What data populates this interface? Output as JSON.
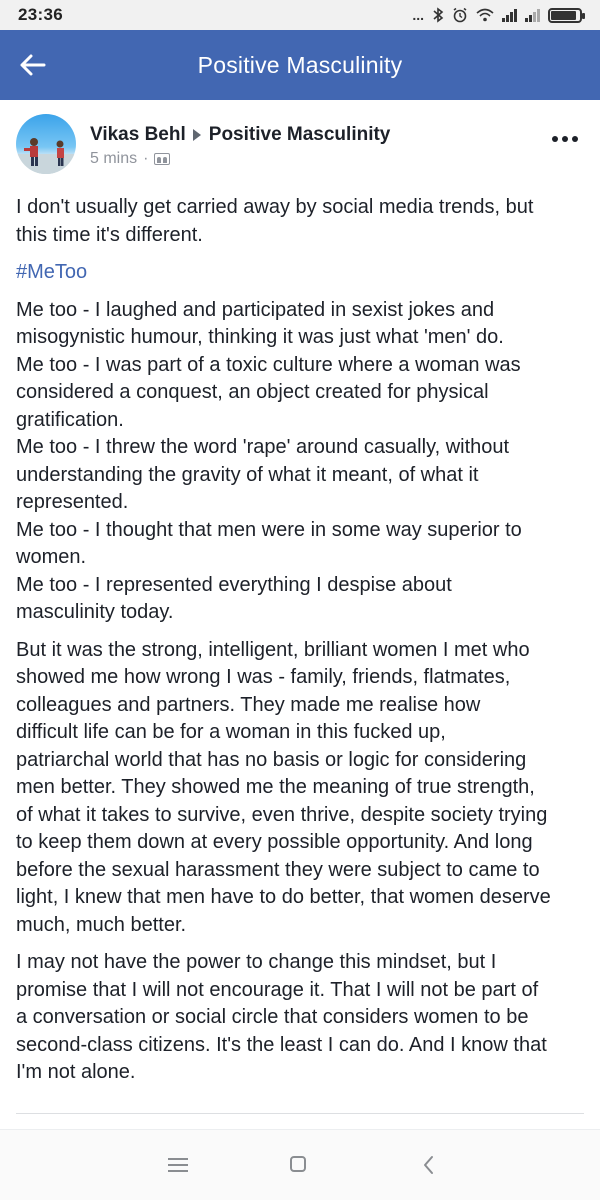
{
  "status_bar": {
    "time": "23:36",
    "dots": "...",
    "battery_level": 0.9
  },
  "app_bar": {
    "title": "Positive Masculinity"
  },
  "post": {
    "author": "Vikas Behl",
    "group": "Positive Masculinity",
    "time": "5 mins",
    "separator": "·",
    "intro_lines": [
      "I don't usually get carried away by social media trends, but",
      "this time it's different."
    ],
    "hashtag": "#MeToo",
    "metoo_lines": [
      "Me too - I laughed and participated in sexist jokes and",
      "misogynistic humour, thinking it was just what 'men' do.",
      "Me too - I was part of a toxic culture where a woman was",
      "considered a conquest, an object created for physical",
      "gratification.",
      "Me too - I threw the word 'rape' around casually, without",
      "understanding the gravity of what it meant, of what it",
      "represented.",
      "Me too - I thought that men were in some way superior to",
      "women.",
      "Me too - I represented everything I despise about",
      "masculinity today."
    ],
    "women_lines": [
      "But it was the strong, intelligent, brilliant women I met who",
      "showed me how wrong I was - family, friends, flatmates,",
      "colleagues and partners. They made me realise how",
      "difficult life can be for a woman in this fucked up,",
      "patriarchal world that has no basis or logic for considering",
      "men better. They showed me the meaning of true strength,",
      "of what it takes to survive, even thrive, despite society trying",
      "to keep them down at every possible opportunity. And long",
      "before the sexual harassment they were subject to came to",
      "light, I knew that men have to do better, that women deserve",
      "much, much better."
    ],
    "promise_lines": [
      "I may not have the power to change this mindset, but I",
      "promise that I will not encourage it. That I will not be part of",
      "a conversation or social circle that considers women to be",
      "second-class citizens. It's the least I can do. And I know that",
      "I'm not alone."
    ]
  },
  "colors": {
    "brand": "#4267b2",
    "text": "#1d2129",
    "meta": "#90949c"
  },
  "icons": [
    "back-arrow-icon",
    "bluetooth-icon",
    "alarm-icon",
    "wifi-icon",
    "signal-icon",
    "battery-icon",
    "audience-icon",
    "more-icon",
    "menu-icon",
    "home-icon",
    "back-icon"
  ]
}
